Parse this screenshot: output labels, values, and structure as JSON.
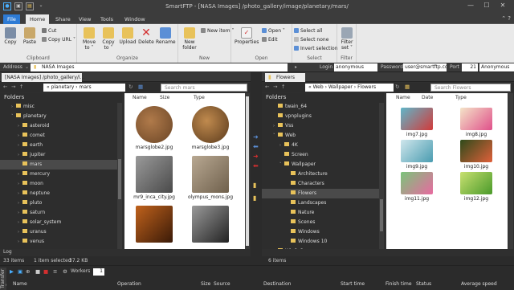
{
  "window": {
    "title": "SmartFTP - [NASA Images] /photo_gallery/image/planetary/mars/",
    "min": "—",
    "max": "☐",
    "close": "✕"
  },
  "menu": [
    "File",
    "Home",
    "Share",
    "View",
    "Tools",
    "Window"
  ],
  "ribbon": {
    "clipboard": {
      "label": "Clipboard",
      "copy": "Copy",
      "paste": "Paste",
      "cut": "Cut",
      "copy_url": "Copy URL ˅"
    },
    "organize": {
      "label": "Organize",
      "move_to": "Move to ˅",
      "copy_to": "Copy to ˅",
      "upload": "Upload",
      "delete": "Delete",
      "rename": "Rename"
    },
    "new": {
      "label": "New",
      "new_folder": "New folder",
      "new_item": "New item ˅"
    },
    "open": {
      "label": "Open",
      "properties": "Properties",
      "open": "Open ˅",
      "edit": "Edit"
    },
    "select": {
      "label": "Select",
      "select_all": "Select all",
      "select_none": "Select none",
      "invert": "Invert selection"
    },
    "filter": {
      "label": "Filter",
      "filter_set": "Filter set ˅"
    }
  },
  "address": {
    "label": "Address",
    "value": "NASA Images",
    "login_label": "Login",
    "login": "anonymous",
    "password_label": "Password",
    "password": "user@smartftp.cor",
    "port_label": "Port",
    "port": "21",
    "mode": "Anonymous"
  },
  "left": {
    "tab": "[NASA Images] /photo_gallery/i...",
    "crumb": "« planetary › mars",
    "search": "Search mars",
    "folders_label": "Folders",
    "tree": [
      {
        "name": "misc",
        "depth": 1,
        "arrow": "›"
      },
      {
        "name": "planetary",
        "depth": 1,
        "arrow": "˅"
      },
      {
        "name": "asteroid",
        "depth": 2,
        "arrow": "›"
      },
      {
        "name": "comet",
        "depth": 2,
        "arrow": "›"
      },
      {
        "name": "earth",
        "depth": 2,
        "arrow": "›"
      },
      {
        "name": "jupiter",
        "depth": 2,
        "arrow": "›"
      },
      {
        "name": "mars",
        "depth": 2,
        "arrow": "",
        "selected": true
      },
      {
        "name": "mercury",
        "depth": 2,
        "arrow": "›"
      },
      {
        "name": "moon",
        "depth": 2,
        "arrow": "›"
      },
      {
        "name": "neptune",
        "depth": 2,
        "arrow": "›"
      },
      {
        "name": "pluto",
        "depth": 2,
        "arrow": "›"
      },
      {
        "name": "saturn",
        "depth": 2,
        "arrow": "›"
      },
      {
        "name": "solar_system",
        "depth": 2,
        "arrow": "›"
      },
      {
        "name": "uranus",
        "depth": 2,
        "arrow": "›"
      },
      {
        "name": "venus",
        "depth": 2,
        "arrow": "›"
      }
    ],
    "log_label": "Log",
    "columns": [
      "Name",
      "Size",
      "Type"
    ],
    "files": [
      {
        "name": "marsglobe2.jpg",
        "c1": "#b07a4a",
        "c2": "#6a4526",
        "round": true
      },
      {
        "name": "marsglobe3.jpg",
        "c1": "#c08a4e",
        "c2": "#5a3a1c",
        "round": true
      },
      {
        "name": "mr9_inca_city.jpg",
        "c1": "#9a9a9a",
        "c2": "#4a4a4a",
        "round": false
      },
      {
        "name": "olympus_mons.jpg",
        "c1": "#b8a892",
        "c2": "#6f604c",
        "round": false
      },
      {
        "name": "",
        "c1": "#c0621c",
        "c2": "#3a1a08",
        "round": false
      },
      {
        "name": "",
        "c1": "#9a9a9a",
        "c2": "#222222",
        "round": false
      }
    ],
    "status": {
      "items": "33 items",
      "selected": "1 item selected",
      "size": "37.2 KB"
    }
  },
  "right": {
    "tab": "Flowers",
    "crumb": "« Web › Wallpaper › Flowers",
    "search": "Search Flowers",
    "folders_label": "Folders",
    "tree": [
      {
        "name": "twain_64",
        "depth": 1,
        "arrow": ""
      },
      {
        "name": "vpnplugins",
        "depth": 1,
        "arrow": ""
      },
      {
        "name": "Vss",
        "depth": 1,
        "arrow": "›"
      },
      {
        "name": "Web",
        "depth": 1,
        "arrow": "˅"
      },
      {
        "name": "4K",
        "depth": 2,
        "arrow": "›"
      },
      {
        "name": "Screen",
        "depth": 2,
        "arrow": ""
      },
      {
        "name": "Wallpaper",
        "depth": 2,
        "arrow": "˅"
      },
      {
        "name": "Architecture",
        "depth": 3,
        "arrow": ""
      },
      {
        "name": "Characters",
        "depth": 3,
        "arrow": ""
      },
      {
        "name": "Flowers",
        "depth": 3,
        "arrow": "",
        "selected": true
      },
      {
        "name": "Landscapes",
        "depth": 3,
        "arrow": ""
      },
      {
        "name": "Nature",
        "depth": 3,
        "arrow": ""
      },
      {
        "name": "Scenes",
        "depth": 3,
        "arrow": ""
      },
      {
        "name": "Windows",
        "depth": 3,
        "arrow": ""
      },
      {
        "name": "Windows 10",
        "depth": 3,
        "arrow": ""
      },
      {
        "name": "WinSxS",
        "depth": 1,
        "arrow": "›"
      }
    ],
    "columns": [
      "Name",
      "Date",
      "Type"
    ],
    "files": [
      {
        "name": "img7.jpg",
        "c1": "#5fb6c9",
        "c2": "#d23a3a"
      },
      {
        "name": "img8.jpg",
        "c1": "#f4e4c8",
        "c2": "#e0508a"
      },
      {
        "name": "img9.jpg",
        "c1": "#cfe6ec",
        "c2": "#4a9cb0"
      },
      {
        "name": "img10.jpg",
        "c1": "#2e4a1a",
        "c2": "#e0603a"
      },
      {
        "name": "img11.jpg",
        "c1": "#7ac47a",
        "c2": "#e86aa0"
      },
      {
        "name": "img12.jpg",
        "c1": "#c8e070",
        "c2": "#4a9a2a"
      }
    ],
    "status": {
      "items": "6 items"
    }
  },
  "transfer": {
    "side_label": "Transfer Queue",
    "workers_label": "Workers",
    "workers": "1",
    "columns": [
      "Name",
      "Operation",
      "Size",
      "Source",
      "Destination",
      "Start time",
      "Finish time",
      "Status",
      "Average speed"
    ]
  },
  "colors": {
    "ribbon": "#e9e9e9",
    "dark": "#2b2b2b",
    "folder": "#e8c25a",
    "accent": "#2d7bd5",
    "delete": "#d32f2f"
  }
}
